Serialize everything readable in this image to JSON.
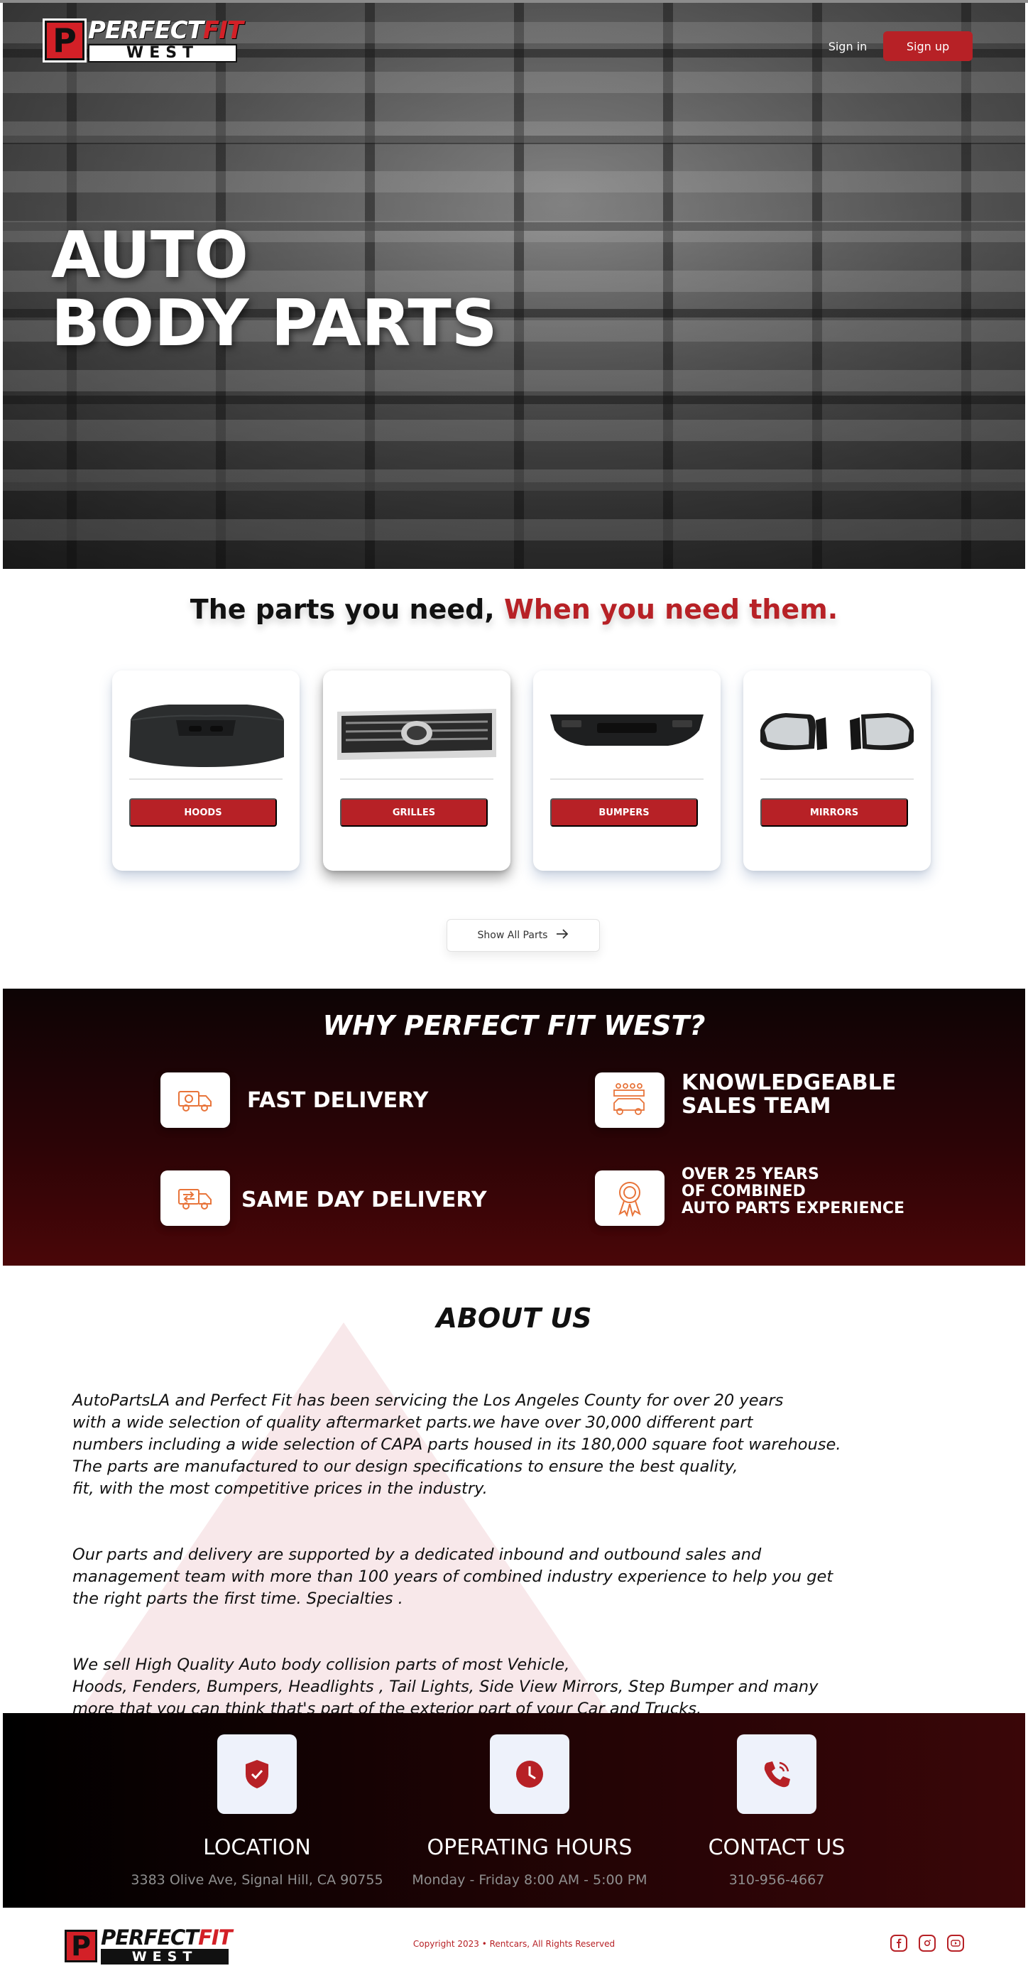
{
  "brand": {
    "logo_mark": "P",
    "name_primary": "PERFECT",
    "name_accent": "FIT",
    "name_sub": "WEST",
    "accent_color": "#b72126"
  },
  "nav": {
    "sign_in": "Sign in",
    "sign_up": "Sign up"
  },
  "hero": {
    "title_line1": "AUTO",
    "title_line2": "BODY PARTS"
  },
  "parts": {
    "tagline_start": "The parts you need, ",
    "tagline_accent": "When you need them.",
    "categories": [
      {
        "label": "HOODS",
        "icon": "hood-image"
      },
      {
        "label": "GRILLES",
        "icon": "grille-image"
      },
      {
        "label": "BUMPERS",
        "icon": "bumper-image"
      },
      {
        "label": "MIRRORS",
        "icon": "mirrors-image"
      }
    ],
    "show_all": "Show All Parts",
    "show_all_icon": "arrow-right-icon"
  },
  "why": {
    "title": "WHY PERFECT FIT WEST?",
    "features": [
      {
        "label": "FAST DELIVERY",
        "icon": "delivery-truck-icon"
      },
      {
        "label_line1": "KNOWLEDGEABLE",
        "label_line2": "SALES TEAM",
        "icon": "sales-team-icon"
      },
      {
        "label": "SAME DAY DELIVERY",
        "icon": "same-day-truck-icon"
      },
      {
        "label_line1": "OVER 25 YEARS",
        "label_line2": "OF  COMBINED",
        "label_line3": "AUTO  PARTS EXPERIENCE",
        "icon": "award-ribbon-icon"
      }
    ]
  },
  "about": {
    "title": "ABOUT US",
    "paragraph1": "AutoPartsLA and Perfect Fit has been servicing the Los Angeles County for over 20 years\n with  a wide selection of quality aftermarket parts.we have over 30,000 different part\nnumbers  including a wide selection of CAPA parts housed in its 180,000 square foot warehouse.\nThe  parts are manufactured to our design specifications to ensure the best quality,\nfit, with the  most competitive prices in the industry.",
    "paragraph2": "Our parts and delivery are supported by a dedicated inbound and outbound sales and\nmanagement team with more than 100 years of combined industry experience to help you get\nthe right parts the first time. Specialties .",
    "paragraph3": "We sell High Quality Auto body collision parts of most Vehicle,\nHoods, Fenders, Bumpers,  Headlights , Tail Lights, Side View Mirrors, Step Bumper and many\nmore that you can think  that's part of the exterior part of your Car and Trucks."
  },
  "contact": [
    {
      "title": "LOCATION",
      "value": "3383 Olive Ave, Signal Hill, CA 90755",
      "icon": "shield-check-icon"
    },
    {
      "title": "OPERATING HOURS",
      "value": "Monday - Friday 8:00 AM - 5:00 PM",
      "icon": "clock-icon"
    },
    {
      "title": "CONTACT US",
      "value": "310-956-4667",
      "icon": "phone-icon"
    }
  ],
  "footer": {
    "copyright": "Copyright 2023  •  Rentcars, All Rights Reserved",
    "social": [
      "facebook-icon",
      "instagram-icon",
      "youtube-icon"
    ]
  }
}
